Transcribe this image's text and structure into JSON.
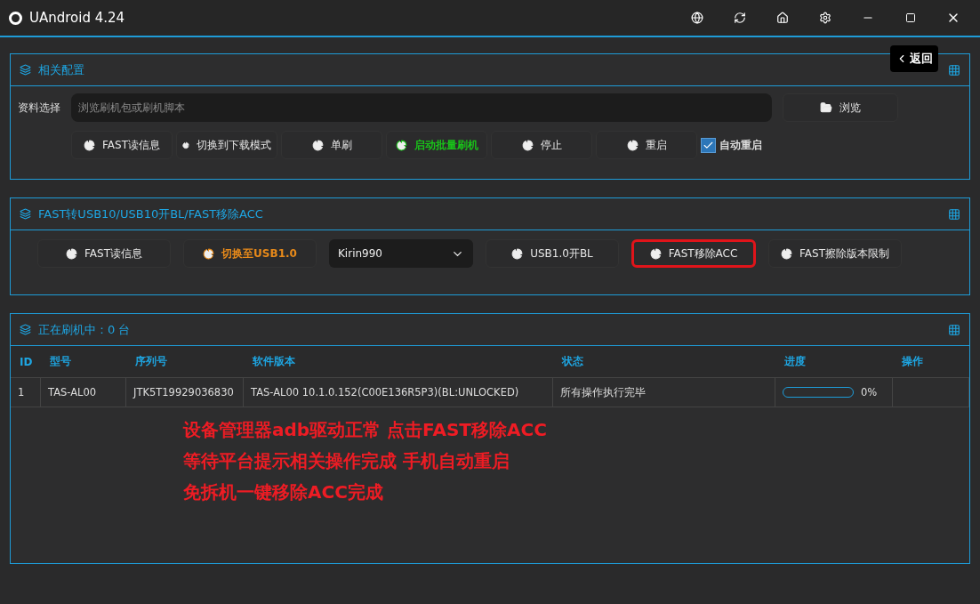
{
  "window": {
    "title": "UAndroid 4.24"
  },
  "back_button": {
    "label": "返回"
  },
  "config_panel": {
    "title": "相关配置",
    "file_label": "资料选择",
    "file_placeholder": "浏览刷机包或刷机脚本",
    "browse_label": "浏览",
    "buttons": [
      {
        "label": "FAST读信息",
        "color": "#e6e6e6"
      },
      {
        "label": "切换到下载模式",
        "color": "#e6e6e6"
      },
      {
        "label": "单刷",
        "color": "#e6e6e6"
      },
      {
        "label": "启动批量刷机",
        "color": "#19c419"
      },
      {
        "label": "停止",
        "color": "#e6e6e6"
      },
      {
        "label": "重启",
        "color": "#e6e6e6"
      }
    ],
    "auto_restart": {
      "label": "自动重启",
      "checked": true
    }
  },
  "fast_panel": {
    "title": "FAST转USB10/USB10开BL/FAST移除ACC",
    "items": [
      {
        "kind": "button",
        "label": "FAST读信息",
        "color": "#e6e6e6",
        "highlighted": false
      },
      {
        "kind": "button",
        "label": "切换至USB1.0",
        "color": "#e88a1a",
        "highlighted": false
      },
      {
        "kind": "select",
        "label": "Kirin990"
      },
      {
        "kind": "button",
        "label": "USB1.0开BL",
        "color": "#e6e6e6",
        "highlighted": false
      },
      {
        "kind": "button",
        "label": "FAST移除ACC",
        "color": "#e6e6e6",
        "highlighted": true
      },
      {
        "kind": "button",
        "label": "FAST擦除版本限制",
        "color": "#e6e6e6",
        "highlighted": false
      }
    ]
  },
  "device_panel": {
    "title": "正在刷机中：0 台",
    "table": {
      "columns": [
        "ID",
        "型号",
        "序列号",
        "软件版本",
        "状态",
        "进度",
        "操作"
      ],
      "rows": [
        {
          "id": "1",
          "model": "TAS-AL00",
          "serial": "JTK5T19929036830",
          "version": "TAS-AL00 10.1.0.152(C00E136R5P3)(BL:UNLOCKED)",
          "status": "所有操作执行完毕",
          "level": 0,
          "reading": "0%"
        }
      ]
    },
    "annotations": [
      "设备管理器adb驱动正常 点击FAST移除ACC",
      "等待平台提示相关操作完成 手机自动重启",
      "免拆机一键移除ACC完成"
    ]
  }
}
